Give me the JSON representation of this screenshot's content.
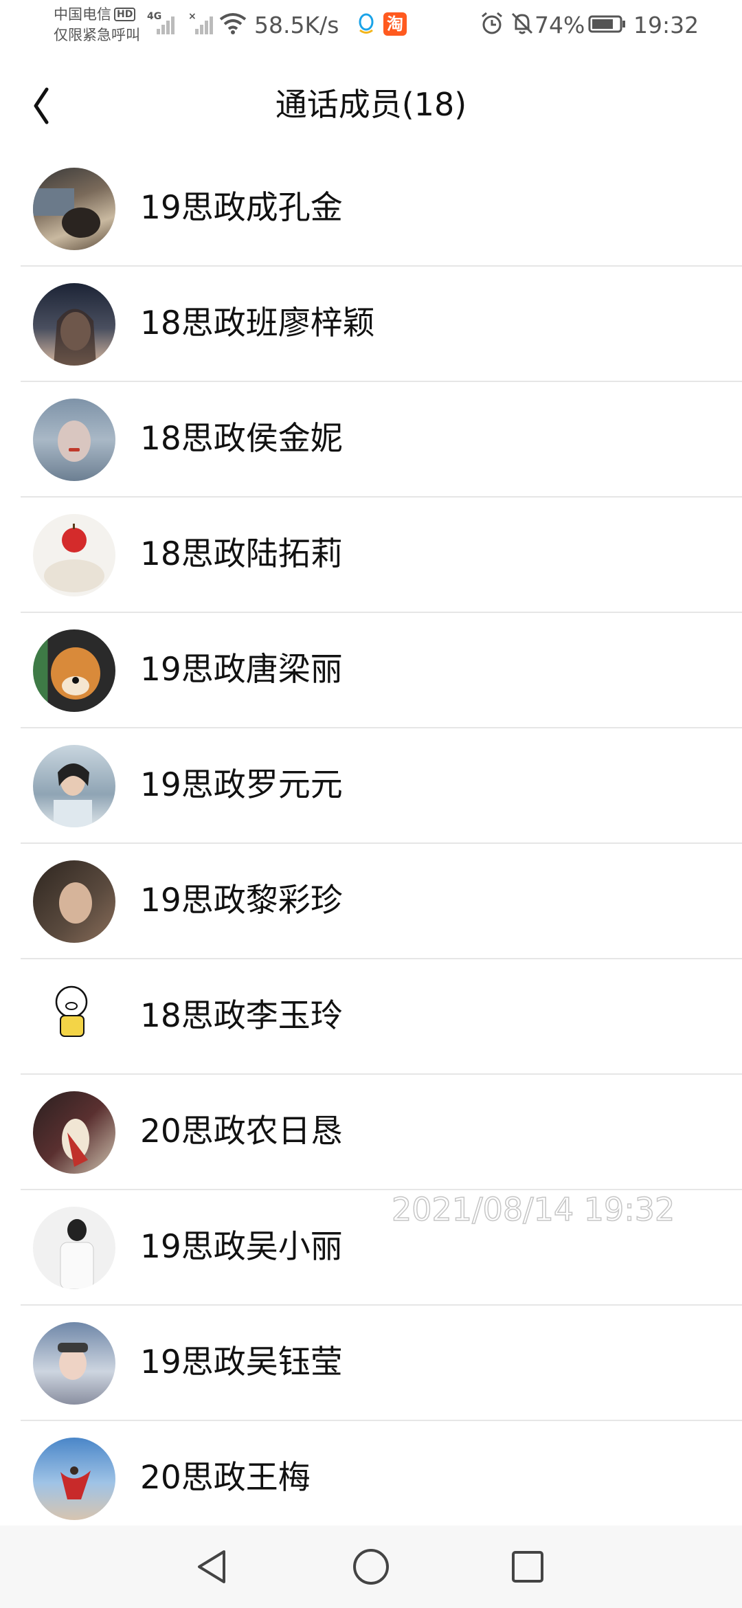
{
  "status_bar": {
    "carrier_line1": "中国电信",
    "carrier_badge": "HD",
    "carrier_line2": "仅限紧急呼叫",
    "network_type": "4G",
    "speed": "58.5K/s",
    "taobao_icon_char": "淘",
    "battery": "74%",
    "time": "19:32"
  },
  "header": {
    "title": "通话成员(18)"
  },
  "members": [
    {
      "name": "19思政成孔金"
    },
    {
      "name": "18思政班廖梓颖"
    },
    {
      "name": "18思政侯金妮"
    },
    {
      "name": "18思政陆拓莉"
    },
    {
      "name": "19思政唐梁丽"
    },
    {
      "name": "19思政罗元元"
    },
    {
      "name": "19思政黎彩珍"
    },
    {
      "name": "18思政李玉玲"
    },
    {
      "name": "20思政农日恳"
    },
    {
      "name": "19思政吴小丽"
    },
    {
      "name": "19思政吴钰莹"
    },
    {
      "name": "20思政王梅"
    }
  ],
  "watermark": "2021/08/14  19:32",
  "colors": {
    "accent_taobao": "#ff5a1f",
    "divider": "#e6e6e6",
    "navbar_bg": "#f7f7f7"
  }
}
